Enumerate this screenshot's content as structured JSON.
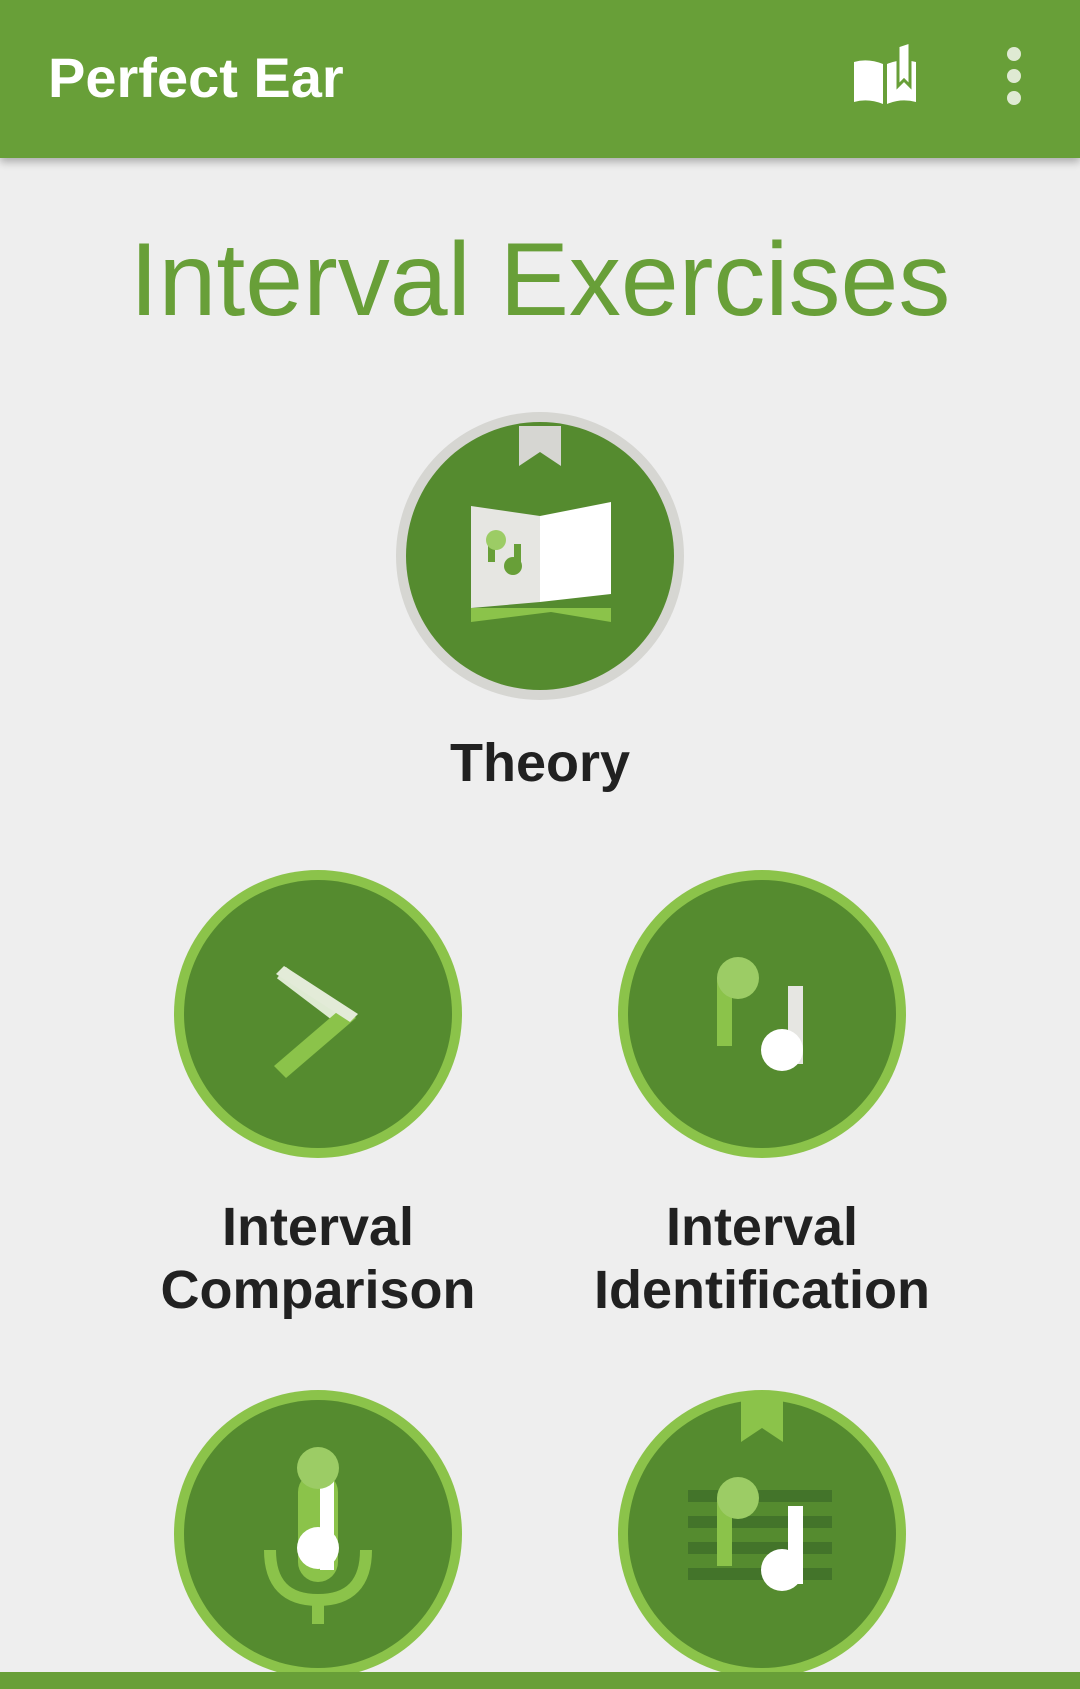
{
  "appbar": {
    "title": "Perfect Ear",
    "actions": [
      {
        "icon": "open-book-icon"
      },
      {
        "icon": "more-vertical-icon"
      }
    ]
  },
  "colors": {
    "primary": "#689f38",
    "circle_fill": "#558b2f",
    "circle_ring": "#8bc34a",
    "theory_ring": "#d6d6d2",
    "accent_light": "#9ccc65",
    "title_text": "#689f38",
    "label_text": "#212121",
    "background": "#eeeeee"
  },
  "page": {
    "title": "Interval Exercises"
  },
  "exercises": [
    {
      "icon": "theory-book-icon",
      "label_lines": [
        "Theory"
      ]
    },
    {
      "icon": "chevron-right-icon",
      "label_lines": [
        "Interval",
        "Comparison"
      ]
    },
    {
      "icon": "music-notes-icon",
      "label_lines": [
        "Interval",
        "Identification"
      ]
    },
    {
      "icon": "microphone-note-icon",
      "label_lines": []
    },
    {
      "icon": "staff-notes-icon",
      "label_lines": []
    }
  ]
}
